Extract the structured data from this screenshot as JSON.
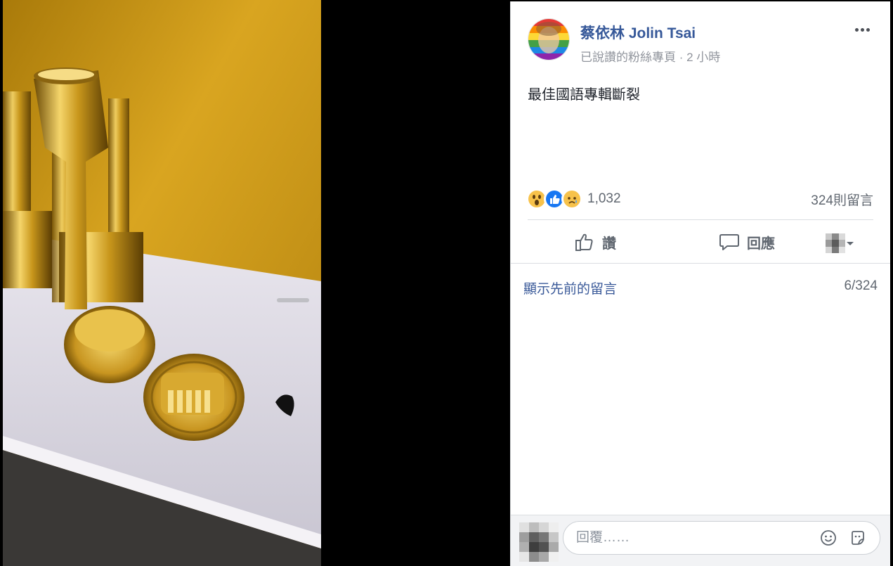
{
  "post": {
    "author": "蔡依林 Jolin Tsai",
    "meta": "已說讚的粉絲專頁 · 2 小時",
    "text": "最佳國語專輯斷裂"
  },
  "reactions": {
    "icons": [
      "wow-icon",
      "like-icon",
      "sad-icon"
    ],
    "count": "1,032",
    "comment_count": "324則留言"
  },
  "actions": {
    "like_label": "讚",
    "comment_label": "回應"
  },
  "comments": {
    "show_previous": "顯示先前的留言",
    "position": "6/324"
  },
  "reply": {
    "placeholder": "回覆……"
  },
  "colors": {
    "link": "#365899",
    "muted": "#90949c",
    "action": "#606770",
    "like_blue": "#1877f2"
  }
}
